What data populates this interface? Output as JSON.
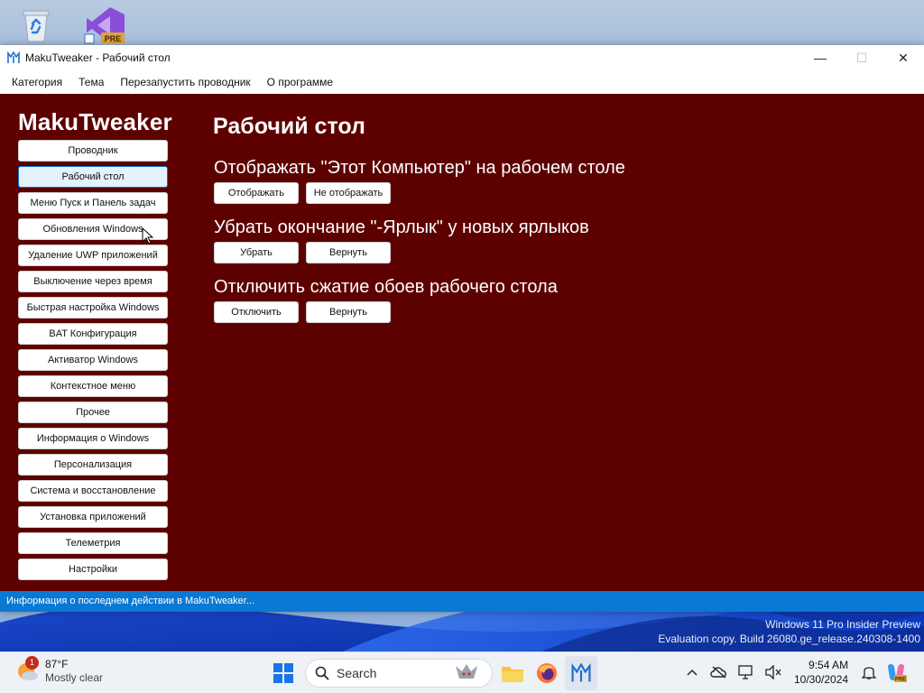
{
  "window": {
    "title": "MakuTweaker - Рабочий стол",
    "minimize": "—",
    "maximize": "☐",
    "close": "✕"
  },
  "menu": [
    "Категория",
    "Тема",
    "Перезапустить проводник",
    "О программе"
  ],
  "sidebar": {
    "brand": "MakuTweaker",
    "items": [
      {
        "label": "Проводник",
        "active": false
      },
      {
        "label": "Рабочий стол",
        "active": true
      },
      {
        "label": "Меню Пуск и Панель задач",
        "active": false
      },
      {
        "label": "Обновления Windows",
        "active": false
      },
      {
        "label": "Удаление UWP приложений",
        "active": false
      },
      {
        "label": "Выключение через время",
        "active": false
      },
      {
        "label": "Быстрая настройка Windows",
        "active": false
      },
      {
        "label": "BAT Конфигурация",
        "active": false
      },
      {
        "label": "Активатор Windows",
        "active": false
      },
      {
        "label": "Контекстное меню",
        "active": false
      },
      {
        "label": "Прочее",
        "active": false
      },
      {
        "label": "Информация о Windows",
        "active": false
      },
      {
        "label": "Персонализация",
        "active": false
      },
      {
        "label": "Система и восстановление",
        "active": false
      },
      {
        "label": "Установка приложений",
        "active": false
      },
      {
        "label": "Телеметрия",
        "active": false
      },
      {
        "label": "Настройки",
        "active": false
      }
    ]
  },
  "main": {
    "title": "Рабочий стол",
    "sections": [
      {
        "title": "Отображать \"Этот Компьютер\" на рабочем столе",
        "buttons": [
          "Отображать",
          "Не отображать"
        ]
      },
      {
        "title": "Убрать окончание \"-Ярлык\" у новых ярлыков",
        "buttons": [
          "Убрать",
          "Вернуть"
        ]
      },
      {
        "title": "Отключить сжатие обоев рабочего стола",
        "buttons": [
          "Отключить",
          "Вернуть"
        ]
      }
    ]
  },
  "status": {
    "text": "Информация о последнем действии в MakuTweaker..."
  },
  "watermark": {
    "line1": "Windows 11 Pro Insider Preview",
    "line2": "Evaluation copy. Build 26080.ge_release.240308-1400"
  },
  "taskbar": {
    "weather": {
      "badge": "1",
      "temp": "87°F",
      "condition": "Mostly clear"
    },
    "search_placeholder": "Search",
    "time": "9:54 AM",
    "date": "10/30/2024"
  },
  "colors": {
    "content_bg": "#5d0000",
    "status_bg": "#0a79d4",
    "active_nav_border": "#0078d4"
  }
}
